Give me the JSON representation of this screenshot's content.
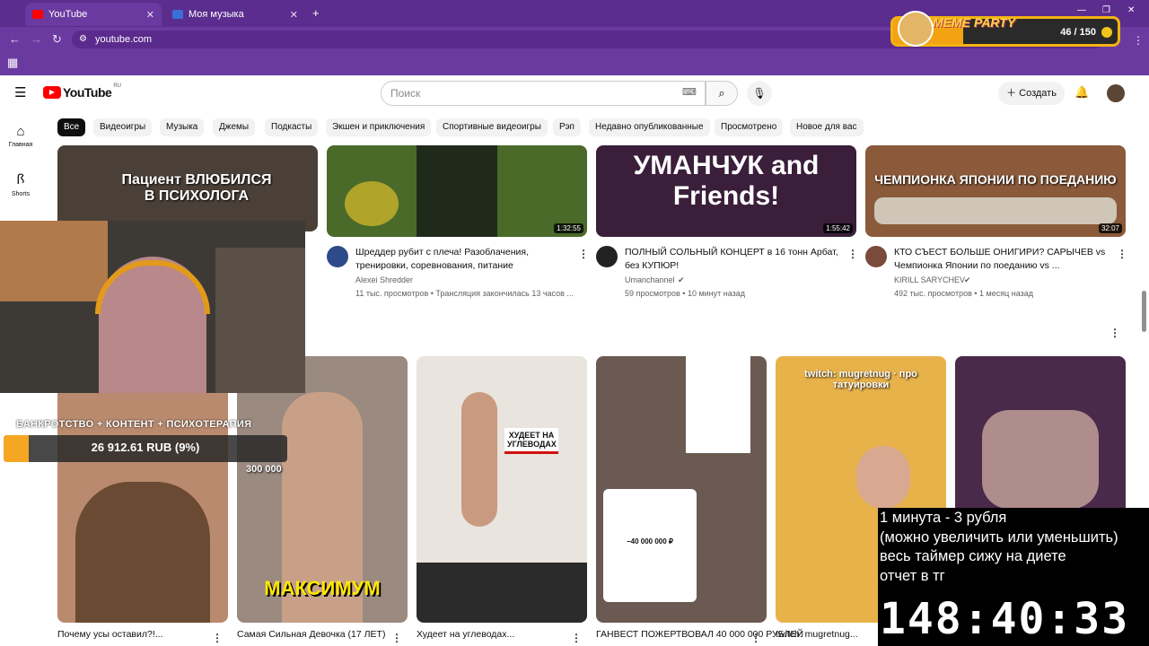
{
  "browser": {
    "tabs": [
      {
        "label": "YouTube",
        "active": true
      },
      {
        "label": "Моя музыка",
        "active": false
      }
    ],
    "url": "youtube.com"
  },
  "overlay_widget": {
    "title": "MEME PARTY",
    "count": "46 / 150"
  },
  "youtube": {
    "logo": "YouTube",
    "region": "RU",
    "search_placeholder": "Поиск",
    "create_label": "Создать",
    "rail": [
      {
        "icon": "home-icon",
        "label": "Главная"
      },
      {
        "icon": "shorts-icon",
        "label": "Shorts"
      }
    ],
    "chips": [
      "Все",
      "Видеоигры",
      "Музыка",
      "Джемы",
      "Подкасты",
      "Экшен и приключения",
      "Спортивные видеоигры",
      "Рэп",
      "Недавно опубликованные",
      "Просмотрено",
      "Новое для вас"
    ]
  },
  "videos": [
    {
      "thumb_text": "Пациент ВЛЮБИЛСЯ В ПСИХОЛОГА",
      "duration": "",
      "title": "",
      "channel": "",
      "meta": ""
    },
    {
      "thumb_text": "",
      "duration": "1:32:55",
      "title": "Шреддер рубит с плеча! Разоблачения, тренировки, соревнования, питание",
      "channel": "Alexei Shredder",
      "meta": "11 тыс. просмотров • Трансляция закончилась 13 часов ..."
    },
    {
      "thumb_text": "УМАНЧУК and Friends!",
      "duration": "1:55:42",
      "title": "ПОЛНЫЙ СОЛЬНЫЙ КОНЦЕРТ в 16 тонн Арбат, без КУПЮР!",
      "channel": "Umanchannel",
      "meta": "59 просмотров • 10 минут назад"
    },
    {
      "thumb_text": "ЧЕМПИОНКА ЯПОНИИ ПО ПОЕДАНИЮ",
      "duration": "32:07",
      "title": "КТО СЪЕСТ БОЛЬШЕ ОНИГИРИ? САРЫЧЕВ vs Чемпионка Японии по поеданию vs ...",
      "channel": "KIRILL SARYCHEV",
      "meta": "492 тыс. просмотров • 1 месяц назад"
    }
  ],
  "shorts": [
    {
      "thumb_text": "",
      "title": "Почему усы оставил?!..."
    },
    {
      "thumb_text": "МАКСИМУМ",
      "views_overlay": "300 000",
      "title": "Самая Сильная Девочка (17 ЛЕТ)"
    },
    {
      "thumb_text": "ХУДЕЕТ НА УГЛЕВОДАХ",
      "title": "Худеет на углеводах..."
    },
    {
      "thumb_text": "−40 000 000 ₽",
      "title": "ГАНВЕСТ ПОЖЕРТВОВАЛ 40 000 000 РУБЛЕЙ"
    },
    {
      "thumb_text": "twitch: mugretnug · про татуировки",
      "title": "twitch: mugretnug..."
    },
    {
      "thumb_text": "",
      "title": ""
    }
  ],
  "stream": {
    "bank_label": "БАНКРОТСТВО + КОНТЕНТ + ПСИХОТЕРАПИЯ",
    "bank_amount": "26 912.61 RUB (9%)",
    "bank_progress": 0.09,
    "timer_lines": [
      "1 минута - 3 рубля",
      "(можно увеличить или уменьшить)",
      "весь таймер сижу на диете",
      "отчет в тг"
    ],
    "timer": "148:40:33"
  }
}
